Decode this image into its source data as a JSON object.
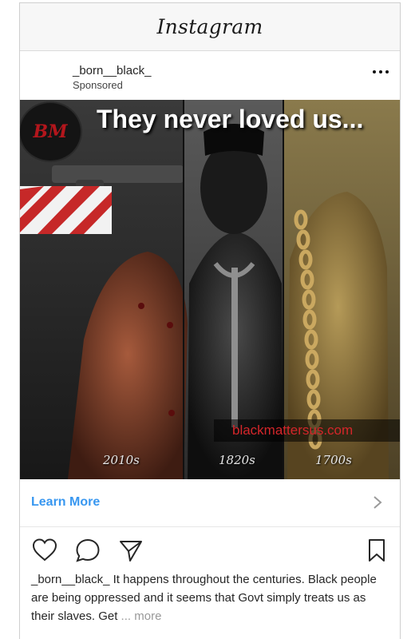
{
  "app": {
    "title": "Instagram"
  },
  "post": {
    "username": "_born__black_",
    "sponsored": "Sponsored",
    "media": {
      "badge_text": "BM",
      "headline": "They never loved us...",
      "url_overlay": "blackmattersus.com",
      "era_labels": [
        "2010s",
        "1820s",
        "1700s"
      ]
    },
    "cta": {
      "label": "Learn More"
    },
    "caption": {
      "username": "_born__black_",
      "text": " It happens throughout the centuries. Black people are being oppressed and it seems that Govt simply treats us as their slaves. Get",
      "ellipsis": " ... ",
      "more": "more"
    }
  },
  "icons": {
    "options": "more-options-icon",
    "like": "heart-icon",
    "comment": "comment-icon",
    "share": "paper-plane-icon",
    "save": "bookmark-icon",
    "chevron": "chevron-right-icon"
  },
  "colors": {
    "link_blue": "#3897f0",
    "url_red": "#d4262a",
    "badge_red": "#b3161c",
    "header_bg": "#f7f7f7"
  }
}
